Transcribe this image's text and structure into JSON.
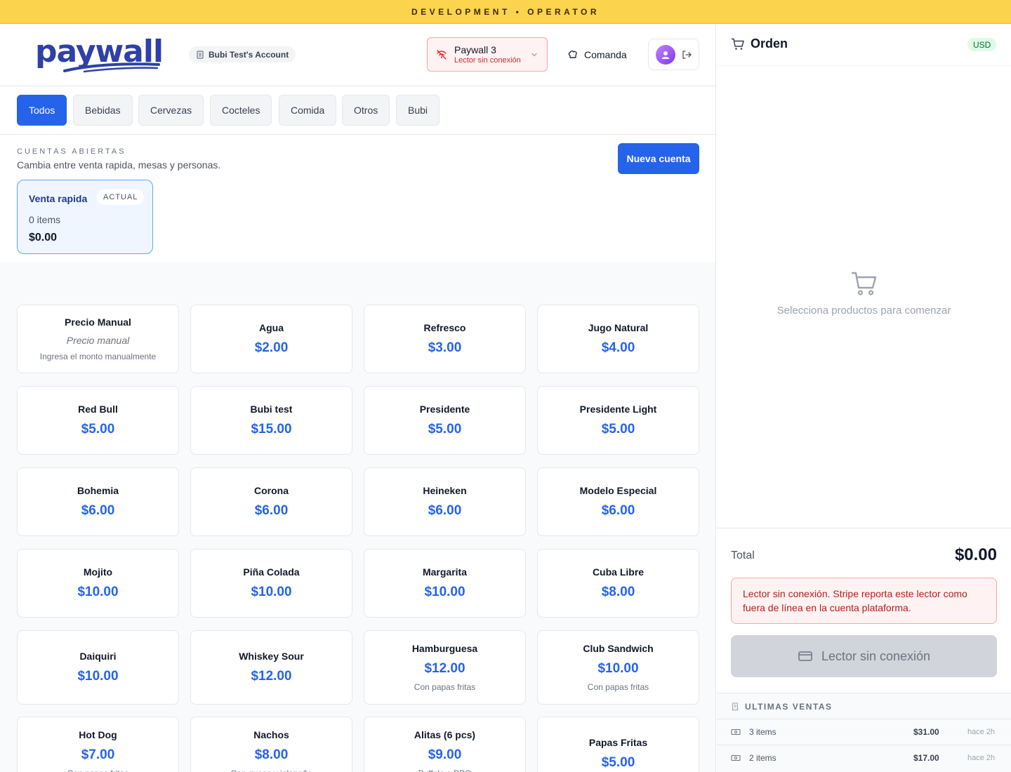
{
  "env_banner": "DEVELOPMENT • OPERATOR",
  "header": {
    "logo": "paywall",
    "account": "Bubi Test's Account",
    "reader": {
      "name": "Paywall 3",
      "status": "Lector sin conexión"
    },
    "comanda": "Comanda"
  },
  "categories": [
    "Todos",
    "Bebidas",
    "Cervezas",
    "Cocteles",
    "Comida",
    "Otros",
    "Bubi"
  ],
  "accounts": {
    "label": "CUENTAS ABIERTAS",
    "subtitle": "Cambia entre venta rapida, mesas y personas.",
    "new_button": "Nueva cuenta",
    "current": {
      "name": "Venta rapida",
      "badge": "ACTUAL",
      "items": "0 items",
      "total": "$0.00"
    }
  },
  "products": [
    {
      "name": "Precio Manual",
      "manual": "Precio manual",
      "desc": "Ingresa el monto manualmente"
    },
    {
      "name": "Agua",
      "price": "$2.00"
    },
    {
      "name": "Refresco",
      "price": "$3.00"
    },
    {
      "name": "Jugo Natural",
      "price": "$4.00"
    },
    {
      "name": "Red Bull",
      "price": "$5.00"
    },
    {
      "name": "Bubi test",
      "price": "$15.00"
    },
    {
      "name": "Presidente",
      "price": "$5.00"
    },
    {
      "name": "Presidente Light",
      "price": "$5.00"
    },
    {
      "name": "Bohemia",
      "price": "$6.00"
    },
    {
      "name": "Corona",
      "price": "$6.00"
    },
    {
      "name": "Heineken",
      "price": "$6.00"
    },
    {
      "name": "Modelo Especial",
      "price": "$6.00"
    },
    {
      "name": "Mojito",
      "price": "$10.00"
    },
    {
      "name": "Piña Colada",
      "price": "$10.00"
    },
    {
      "name": "Margarita",
      "price": "$10.00"
    },
    {
      "name": "Cuba Libre",
      "price": "$8.00"
    },
    {
      "name": "Daiquiri",
      "price": "$10.00"
    },
    {
      "name": "Whiskey Sour",
      "price": "$12.00"
    },
    {
      "name": "Hamburguesa",
      "price": "$12.00",
      "desc": "Con papas fritas"
    },
    {
      "name": "Club Sandwich",
      "price": "$10.00",
      "desc": "Con papas fritas"
    },
    {
      "name": "Hot Dog",
      "price": "$7.00",
      "desc": "Con papas fritas"
    },
    {
      "name": "Nachos",
      "price": "$8.00",
      "desc": "Con queso y jalapeño"
    },
    {
      "name": "Alitas (6 pcs)",
      "price": "$9.00",
      "desc": "Buffalo o BBQ"
    },
    {
      "name": "Papas Fritas",
      "price": "$5.00"
    }
  ],
  "order": {
    "title": "Orden",
    "currency": "USD",
    "empty": "Selecciona productos para comenzar",
    "total_label": "Total",
    "total_value": "$0.00",
    "error": "Lector sin conexión. Stripe reporta este lector como fuera de línea en la cuenta plataforma.",
    "pay_button": "Lector sin conexión",
    "recent_label": "ULTIMAS VENTAS",
    "recent": [
      {
        "items": "3 items",
        "amount": "$31.00",
        "time": "hace 2h"
      },
      {
        "items": "2 items",
        "amount": "$17.00",
        "time": "hace 2h"
      }
    ]
  }
}
